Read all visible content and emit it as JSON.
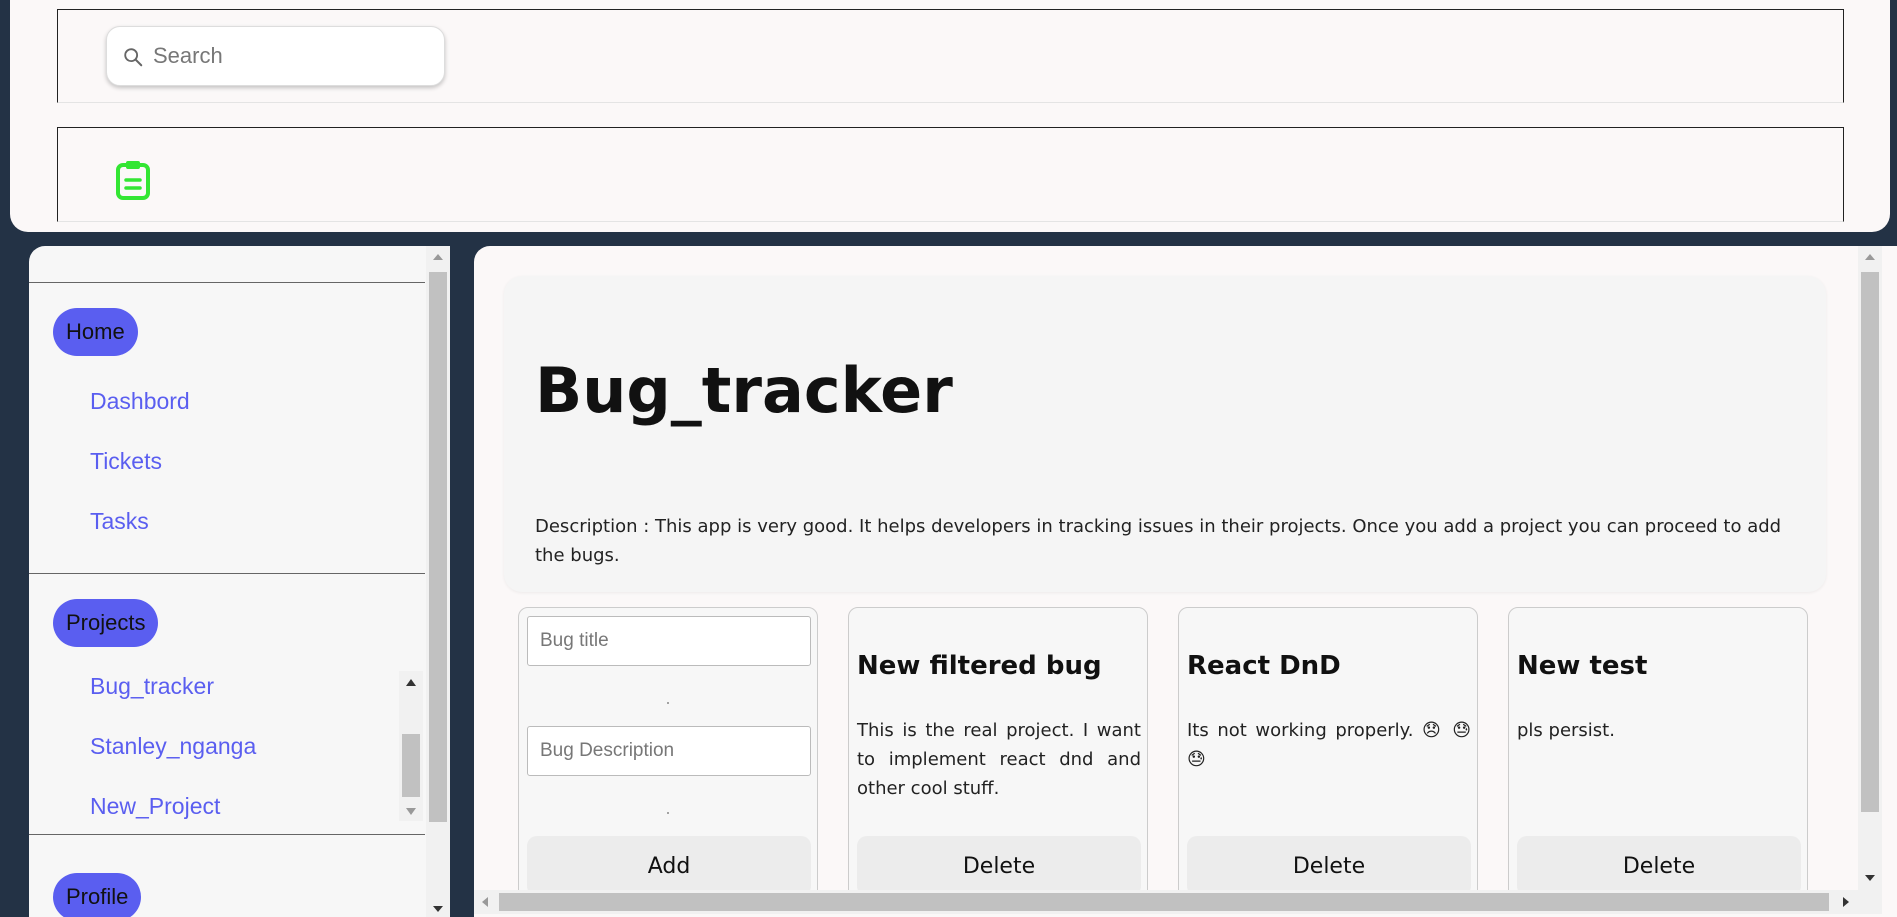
{
  "search": {
    "placeholder": "Search"
  },
  "icons": {
    "search": "search-icon",
    "clipboard": "clipboard-icon",
    "clipboard_color": "#33e633"
  },
  "sidebar": {
    "sections": [
      {
        "label": "Home",
        "items": [
          "Dashbord",
          "Tickets",
          "Tasks"
        ]
      },
      {
        "label": "Projects",
        "items": [
          "Bug_tracker",
          "Stanley_nganga",
          "New_Project"
        ]
      },
      {
        "label": "Profile",
        "items": []
      }
    ],
    "accent": "#5a5ef0"
  },
  "project": {
    "title": "Bug_tracker",
    "description": "Description : This app is very good. It helps developers in tracking issues in their projects. Once you add a project you can proceed to add the bugs."
  },
  "add_card": {
    "title_placeholder": "Bug title",
    "description_placeholder": "Bug Description",
    "button_label": "Add"
  },
  "bugs": [
    {
      "title": "New filtered bug",
      "description": "This is the real project. I want to implement react dnd and other cool stuff.",
      "button_label": "Delete"
    },
    {
      "title": "React DnD",
      "description": "Its not working properly. 😞 😓 😓",
      "button_label": "Delete"
    },
    {
      "title": "New test",
      "description": "pls persist.",
      "button_label": "Delete"
    }
  ]
}
